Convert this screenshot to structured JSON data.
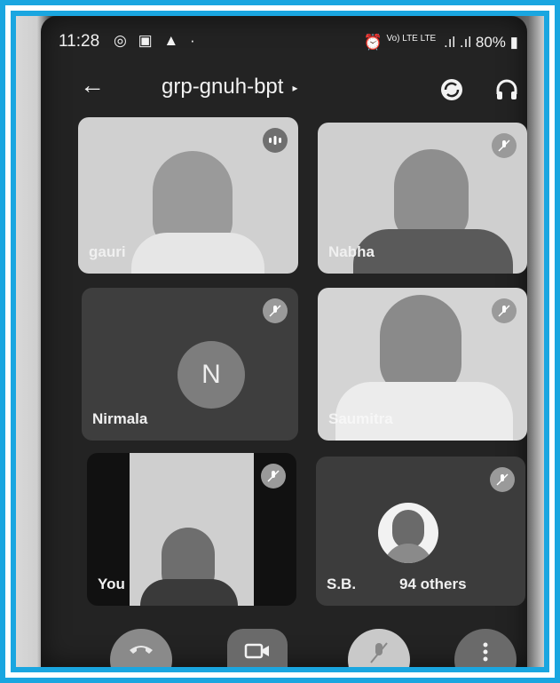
{
  "status_bar": {
    "time": "11:28",
    "left_icons": [
      "whatsapp-icon",
      "image-icon",
      "warning-icon",
      "dot-icon"
    ],
    "network_small": "Vo) LTE  LTE",
    "signal": ".ıl .ıl",
    "battery": "80%"
  },
  "header": {
    "back_glyph": "←",
    "meeting_code": "grp-gnuh-bpt",
    "caret": "▸"
  },
  "participants": [
    {
      "name": "gauri",
      "mic_state": "speaking"
    },
    {
      "name": "Nabha",
      "mic_state": "muted"
    },
    {
      "name": "Nirmala",
      "initial": "N",
      "mic_state": "muted"
    },
    {
      "name": "Saumitra",
      "mic_state": "muted"
    },
    {
      "name": "You",
      "mic_state": "muted"
    },
    {
      "name": "S.B.",
      "others_label": "94 others",
      "mic_state": "muted"
    }
  ],
  "controls": [
    "end-call",
    "camera",
    "microphone-muted",
    "more-options"
  ],
  "colors": {
    "frame": "#1aa6e0",
    "end_call": "#9a9a9a"
  }
}
